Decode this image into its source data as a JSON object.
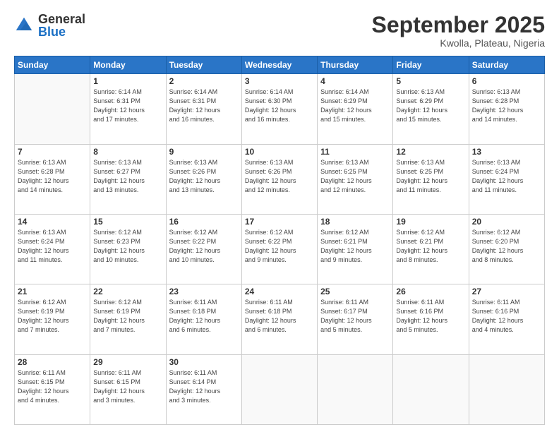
{
  "header": {
    "logo": {
      "general": "General",
      "blue": "Blue"
    },
    "month": "September 2025",
    "location": "Kwolla, Plateau, Nigeria"
  },
  "days_of_week": [
    "Sunday",
    "Monday",
    "Tuesday",
    "Wednesday",
    "Thursday",
    "Friday",
    "Saturday"
  ],
  "weeks": [
    [
      {
        "day": "",
        "info": ""
      },
      {
        "day": "1",
        "info": "Sunrise: 6:14 AM\nSunset: 6:31 PM\nDaylight: 12 hours\nand 17 minutes."
      },
      {
        "day": "2",
        "info": "Sunrise: 6:14 AM\nSunset: 6:31 PM\nDaylight: 12 hours\nand 16 minutes."
      },
      {
        "day": "3",
        "info": "Sunrise: 6:14 AM\nSunset: 6:30 PM\nDaylight: 12 hours\nand 16 minutes."
      },
      {
        "day": "4",
        "info": "Sunrise: 6:14 AM\nSunset: 6:29 PM\nDaylight: 12 hours\nand 15 minutes."
      },
      {
        "day": "5",
        "info": "Sunrise: 6:13 AM\nSunset: 6:29 PM\nDaylight: 12 hours\nand 15 minutes."
      },
      {
        "day": "6",
        "info": "Sunrise: 6:13 AM\nSunset: 6:28 PM\nDaylight: 12 hours\nand 14 minutes."
      }
    ],
    [
      {
        "day": "7",
        "info": "Sunrise: 6:13 AM\nSunset: 6:28 PM\nDaylight: 12 hours\nand 14 minutes."
      },
      {
        "day": "8",
        "info": "Sunrise: 6:13 AM\nSunset: 6:27 PM\nDaylight: 12 hours\nand 13 minutes."
      },
      {
        "day": "9",
        "info": "Sunrise: 6:13 AM\nSunset: 6:26 PM\nDaylight: 12 hours\nand 13 minutes."
      },
      {
        "day": "10",
        "info": "Sunrise: 6:13 AM\nSunset: 6:26 PM\nDaylight: 12 hours\nand 12 minutes."
      },
      {
        "day": "11",
        "info": "Sunrise: 6:13 AM\nSunset: 6:25 PM\nDaylight: 12 hours\nand 12 minutes."
      },
      {
        "day": "12",
        "info": "Sunrise: 6:13 AM\nSunset: 6:25 PM\nDaylight: 12 hours\nand 11 minutes."
      },
      {
        "day": "13",
        "info": "Sunrise: 6:13 AM\nSunset: 6:24 PM\nDaylight: 12 hours\nand 11 minutes."
      }
    ],
    [
      {
        "day": "14",
        "info": "Sunrise: 6:13 AM\nSunset: 6:24 PM\nDaylight: 12 hours\nand 11 minutes."
      },
      {
        "day": "15",
        "info": "Sunrise: 6:12 AM\nSunset: 6:23 PM\nDaylight: 12 hours\nand 10 minutes."
      },
      {
        "day": "16",
        "info": "Sunrise: 6:12 AM\nSunset: 6:22 PM\nDaylight: 12 hours\nand 10 minutes."
      },
      {
        "day": "17",
        "info": "Sunrise: 6:12 AM\nSunset: 6:22 PM\nDaylight: 12 hours\nand 9 minutes."
      },
      {
        "day": "18",
        "info": "Sunrise: 6:12 AM\nSunset: 6:21 PM\nDaylight: 12 hours\nand 9 minutes."
      },
      {
        "day": "19",
        "info": "Sunrise: 6:12 AM\nSunset: 6:21 PM\nDaylight: 12 hours\nand 8 minutes."
      },
      {
        "day": "20",
        "info": "Sunrise: 6:12 AM\nSunset: 6:20 PM\nDaylight: 12 hours\nand 8 minutes."
      }
    ],
    [
      {
        "day": "21",
        "info": "Sunrise: 6:12 AM\nSunset: 6:19 PM\nDaylight: 12 hours\nand 7 minutes."
      },
      {
        "day": "22",
        "info": "Sunrise: 6:12 AM\nSunset: 6:19 PM\nDaylight: 12 hours\nand 7 minutes."
      },
      {
        "day": "23",
        "info": "Sunrise: 6:11 AM\nSunset: 6:18 PM\nDaylight: 12 hours\nand 6 minutes."
      },
      {
        "day": "24",
        "info": "Sunrise: 6:11 AM\nSunset: 6:18 PM\nDaylight: 12 hours\nand 6 minutes."
      },
      {
        "day": "25",
        "info": "Sunrise: 6:11 AM\nSunset: 6:17 PM\nDaylight: 12 hours\nand 5 minutes."
      },
      {
        "day": "26",
        "info": "Sunrise: 6:11 AM\nSunset: 6:16 PM\nDaylight: 12 hours\nand 5 minutes."
      },
      {
        "day": "27",
        "info": "Sunrise: 6:11 AM\nSunset: 6:16 PM\nDaylight: 12 hours\nand 4 minutes."
      }
    ],
    [
      {
        "day": "28",
        "info": "Sunrise: 6:11 AM\nSunset: 6:15 PM\nDaylight: 12 hours\nand 4 minutes."
      },
      {
        "day": "29",
        "info": "Sunrise: 6:11 AM\nSunset: 6:15 PM\nDaylight: 12 hours\nand 3 minutes."
      },
      {
        "day": "30",
        "info": "Sunrise: 6:11 AM\nSunset: 6:14 PM\nDaylight: 12 hours\nand 3 minutes."
      },
      {
        "day": "",
        "info": ""
      },
      {
        "day": "",
        "info": ""
      },
      {
        "day": "",
        "info": ""
      },
      {
        "day": "",
        "info": ""
      }
    ]
  ]
}
